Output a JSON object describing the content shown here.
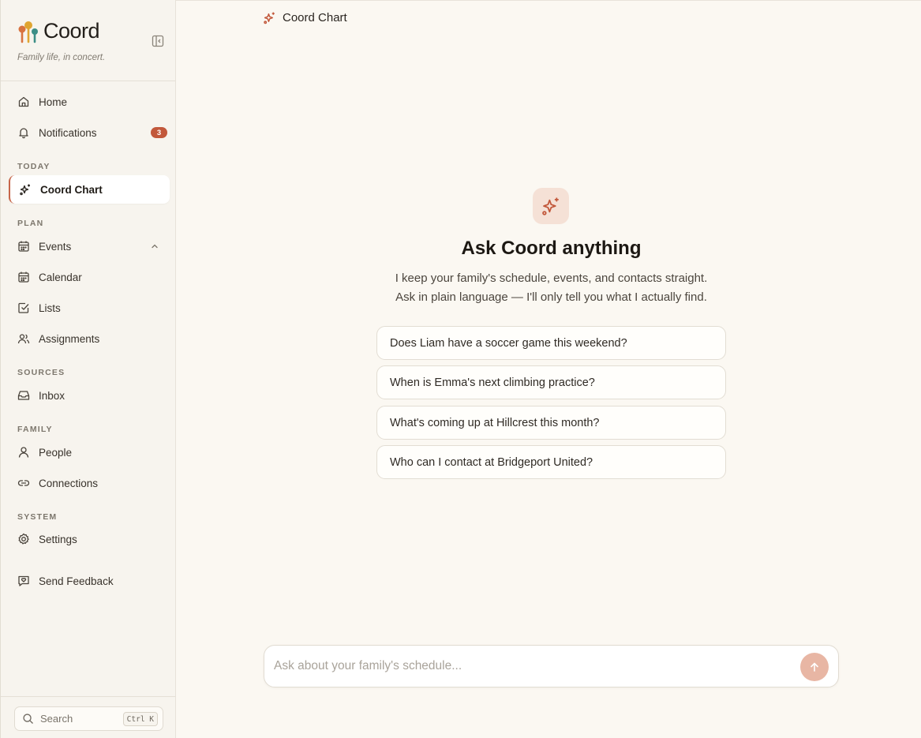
{
  "brand": {
    "name": "Coord",
    "tagline": "Family life, in concert."
  },
  "sidebar": {
    "top_items": [
      {
        "label": "Home",
        "icon": "home-icon"
      },
      {
        "label": "Notifications",
        "icon": "bell-icon",
        "badge": "3"
      }
    ],
    "sections": [
      {
        "label": "TODAY",
        "items": [
          {
            "label": "Coord Chart",
            "icon": "sparkles-icon",
            "active": true
          }
        ]
      },
      {
        "label": "PLAN",
        "items": [
          {
            "label": "Events",
            "icon": "calendar-icon",
            "expanded": true
          },
          {
            "label": "Calendar",
            "icon": "calendar-icon"
          },
          {
            "label": "Lists",
            "icon": "checkbox-icon"
          },
          {
            "label": "Assignments",
            "icon": "users-icon"
          }
        ]
      },
      {
        "label": "SOURCES",
        "items": [
          {
            "label": "Inbox",
            "icon": "inbox-icon"
          }
        ]
      },
      {
        "label": "FAMILY",
        "items": [
          {
            "label": "People",
            "icon": "user-icon"
          },
          {
            "label": "Connections",
            "icon": "link-icon"
          }
        ]
      },
      {
        "label": "SYSTEM",
        "items": [
          {
            "label": "Settings",
            "icon": "gear-icon"
          }
        ]
      }
    ],
    "feedback_label": "Send Feedback",
    "search": {
      "label": "Search",
      "shortcut": "Ctrl K"
    }
  },
  "header": {
    "title": "Coord Chart"
  },
  "hero": {
    "title": "Ask Coord anything",
    "subtitle_line1": "I keep your family's schedule, events, and contacts straight.",
    "subtitle_line2": "Ask in plain language — I'll only tell you what I actually find."
  },
  "suggestions": [
    "Does Liam have a soccer game this weekend?",
    "When is Emma's next climbing practice?",
    "What's coming up at Hillcrest this month?",
    "Who can I contact at Bridgeport United?"
  ],
  "composer": {
    "placeholder": "Ask about your family's schedule..."
  },
  "colors": {
    "accent": "#c2583b",
    "background": "#fbf8f2",
    "sidebar": "#f7f4ee",
    "send_button": "#e8b6a4"
  }
}
